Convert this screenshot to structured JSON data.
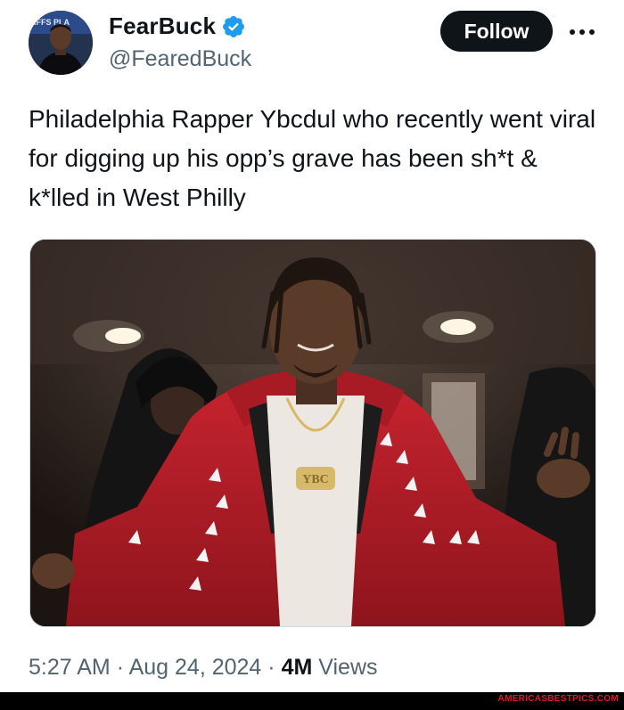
{
  "author": {
    "display_name": "FearBuck",
    "handle": "@FearedBuck",
    "avatar_caption": "IFFS PLA"
  },
  "follow_label": "Follow",
  "tweet": {
    "text": "Philadelphia Rapper Ybcdul who recently went viral for digging up his opp’s grave has been sh*t & k*lled in West Philly",
    "media_caption": "YBC"
  },
  "meta": {
    "time": "5:27 AM",
    "separator": "·",
    "date": "Aug 24, 2024",
    "views_count": "4M",
    "views_label": "Views"
  },
  "watermark": "AMERICASBESTPICS.COM",
  "colors": {
    "accent_blue": "#1d9bf0",
    "text_primary": "#0f1419",
    "text_secondary": "#536471",
    "jacket_red": "#b5202b"
  }
}
